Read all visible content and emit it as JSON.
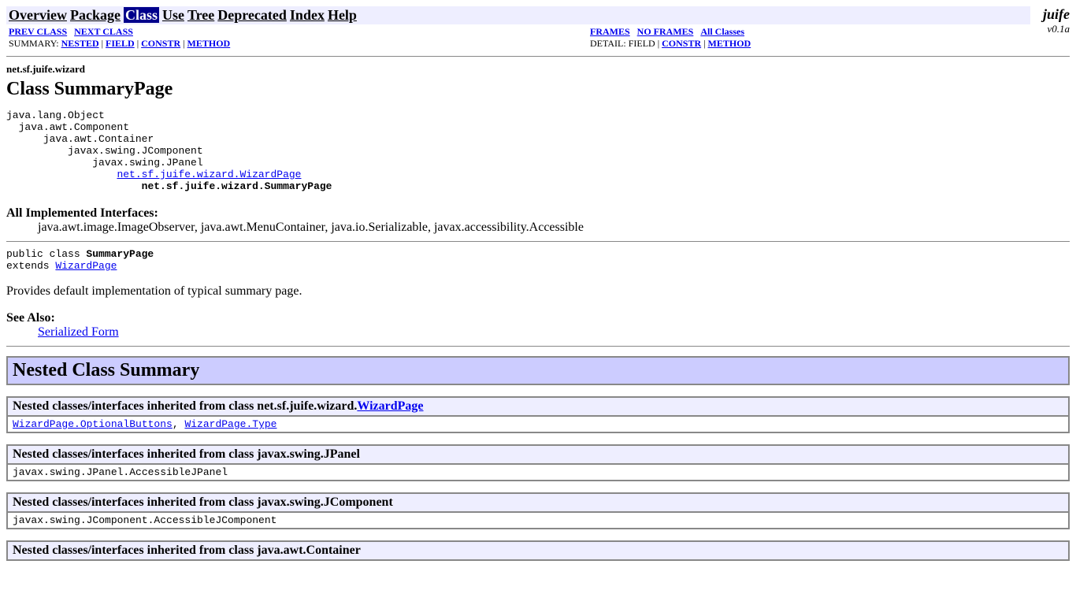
{
  "brand": {
    "name": "juife",
    "version": "v0.1a"
  },
  "nav": {
    "overview": "Overview",
    "package": "Package",
    "class": "Class",
    "use": "Use",
    "tree": "Tree",
    "deprecated": "Deprecated",
    "index": "Index",
    "help": "Help"
  },
  "subnav": {
    "prev_class": "PREV CLASS",
    "next_class": "NEXT CLASS",
    "frames": "FRAMES",
    "no_frames": "NO FRAMES",
    "all_classes": "All Classes",
    "summary_label": "SUMMARY: ",
    "nested": "NESTED",
    "field": "FIELD",
    "constr": "CONSTR",
    "method": "METHOD",
    "detail_label": "DETAIL: ",
    "detail_field": "FIELD",
    "detail_constr": "CONSTR",
    "detail_method": "METHOD"
  },
  "header": {
    "package": "net.sf.juife.wizard",
    "class_label": "Class SummaryPage"
  },
  "hierarchy": {
    "l0": "java.lang.Object",
    "l1": "java.awt.Component",
    "l2": "java.awt.Container",
    "l3": "javax.swing.JComponent",
    "l4": "javax.swing.JPanel",
    "l5": "net.sf.juife.wizard.WizardPage",
    "l6": "net.sf.juife.wizard.SummaryPage"
  },
  "interfaces": {
    "label": "All Implemented Interfaces:",
    "list": "java.awt.image.ImageObserver, java.awt.MenuContainer, java.io.Serializable, javax.accessibility.Accessible"
  },
  "signature": {
    "pre": "public class ",
    "name": "SummaryPage",
    "ext": "extends ",
    "link": "WizardPage"
  },
  "description": "Provides default implementation of typical summary page.",
  "see_also": {
    "label": "See Also:",
    "link": "Serialized Form"
  },
  "nested": {
    "heading": "Nested Class Summary",
    "wizard_prefix": "Nested classes/interfaces inherited from class net.sf.juife.wizard.",
    "wizard_link": "WizardPage",
    "wizard_item1": "WizardPage.OptionalButtons",
    "wizard_item2": "WizardPage.Type",
    "jpanel_heading": "Nested classes/interfaces inherited from class javax.swing.JPanel",
    "jpanel_body": "javax.swing.JPanel.AccessibleJPanel",
    "jcomp_heading": "Nested classes/interfaces inherited from class javax.swing.JComponent",
    "jcomp_body": "javax.swing.JComponent.AccessibleJComponent",
    "container_heading": "Nested classes/interfaces inherited from class java.awt.Container"
  }
}
